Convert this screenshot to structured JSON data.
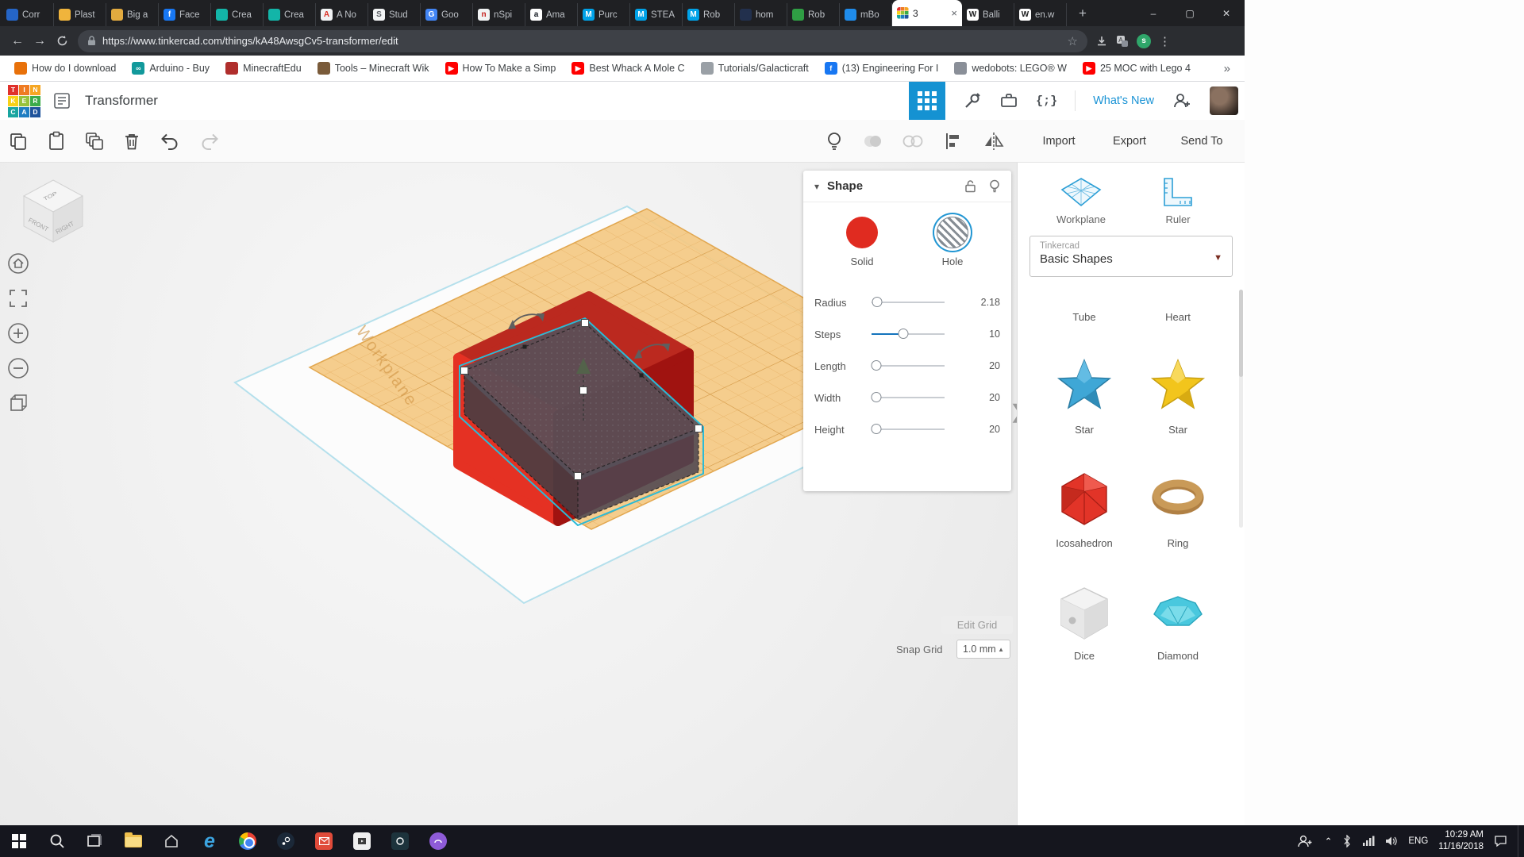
{
  "icons": {
    "back": "←",
    "forward": "→",
    "overflow": "»",
    "menu": "⋮",
    "star": "☆",
    "plus_tab": "+",
    "caret_down": "▾",
    "caret_up": "▲",
    "drop_caret": "▼",
    "collapse_chevron": "❯",
    "tab_close": "×",
    "code_braces": "{;}",
    "window_min": "–",
    "window_max": "▢",
    "window_close": "✕"
  },
  "browser": {
    "tabs": [
      {
        "label": "Corr",
        "fav": "#2565c7",
        "glyph": "",
        "glyph_color": "#ffffff"
      },
      {
        "label": "Plast",
        "fav": "#f0b43c",
        "glyph": "",
        "glyph_color": "#ffffff"
      },
      {
        "label": "Big a",
        "fav": "#e2aa3f",
        "glyph": "",
        "glyph_color": "#ffffff"
      },
      {
        "label": "Face",
        "fav": "#1877f2",
        "glyph": "f",
        "glyph_color": "#ffffff"
      },
      {
        "label": "Crea",
        "fav": "#13b5a8",
        "glyph": "",
        "glyph_color": "#ffffff"
      },
      {
        "label": "Crea",
        "fav": "#13b5a8",
        "glyph": "",
        "glyph_color": "#ffffff"
      },
      {
        "label": "A No",
        "fav": "#f1f3f4",
        "glyph": "A",
        "glyph_color": "#d93025"
      },
      {
        "label": "Stud",
        "fav": "#f1f3f4",
        "glyph": "S",
        "glyph_color": "#5f6368"
      },
      {
        "label": "Goo",
        "fav": "#4285f4",
        "glyph": "G",
        "glyph_color": "#ffffff"
      },
      {
        "label": "nSpi",
        "fav": "#f1f3f4",
        "glyph": "n",
        "glyph_color": "#c5221f"
      },
      {
        "label": "Ama",
        "fav": "#ffffff",
        "glyph": "a",
        "glyph_color": "#131921"
      },
      {
        "label": "Purc",
        "fav": "#00a2e8",
        "glyph": "M",
        "glyph_color": "#ffffff"
      },
      {
        "label": "STEA",
        "fav": "#00a2e8",
        "glyph": "M",
        "glyph_color": "#ffffff"
      },
      {
        "label": "Rob",
        "fav": "#00a2e8",
        "glyph": "M",
        "glyph_color": "#ffffff"
      },
      {
        "label": "hom",
        "fav": "#22304d",
        "glyph": "",
        "glyph_color": "#ffffff"
      },
      {
        "label": "Rob",
        "fav": "#2f9e44",
        "glyph": "",
        "glyph_color": "#ffffff"
      },
      {
        "label": "mBo",
        "fav": "#1f8ceb",
        "glyph": "",
        "glyph_color": "#ffffff"
      },
      {
        "label": "3",
        "active": true
      },
      {
        "label": "Balli",
        "fav": "#ffffff",
        "glyph": "W",
        "glyph_color": "#202122"
      },
      {
        "label": "en.w",
        "fav": "#ffffff",
        "glyph": "W",
        "glyph_color": "#202122"
      }
    ],
    "url": "https://www.tinkercad.com/things/kA48AwsgCv5-transformer/edit",
    "bookmarks": [
      {
        "label": "How do I download",
        "color": "#e8710a",
        "glyph": ""
      },
      {
        "label": "Arduino - Buy",
        "color": "#12999b",
        "glyph": "∞"
      },
      {
        "label": "MinecraftEdu",
        "color": "#b02e2c",
        "glyph": ""
      },
      {
        "label": "Tools – Minecraft Wik",
        "color": "#7a5b3a",
        "glyph": ""
      },
      {
        "label": "How To Make a Simp",
        "color": "#ff0000",
        "glyph": "▶"
      },
      {
        "label": "Best Whack A Mole C",
        "color": "#ff0000",
        "glyph": "▶"
      },
      {
        "label": "Tutorials/Galacticraft",
        "color": "#9aa0a6",
        "glyph": ""
      },
      {
        "label": "(13) Engineering For I",
        "color": "#1877f2",
        "glyph": "f"
      },
      {
        "label": "wedobots: LEGO® W",
        "color": "#8a8f98",
        "glyph": ""
      },
      {
        "label": "25 MOC with Lego 4",
        "color": "#ff0000",
        "glyph": "▶"
      }
    ]
  },
  "tinkercad": {
    "logo_letters": [
      "T",
      "I",
      "N",
      "K",
      "E",
      "R",
      "C",
      "A",
      "D"
    ],
    "logo_colors": [
      "#e0312c",
      "#ef7b22",
      "#f5a623",
      "#f7d117",
      "#97c23c",
      "#3bab49",
      "#19a5a0",
      "#1f7ec2",
      "#20549c"
    ],
    "title": "Transformer",
    "whats_new": "What's New",
    "toolbar": {
      "import": "Import",
      "export": "Export",
      "send_to": "Send To"
    },
    "viewcube": {
      "top": "TOP",
      "front": "FRONT",
      "right": "RIGHT"
    },
    "workplane_watermark": "Workplane",
    "shape_panel": {
      "title": "Shape",
      "solid_label": "Solid",
      "hole_label": "Hole",
      "sliders": [
        {
          "label": "Radius",
          "value": "2.18",
          "pos": 8,
          "fill": 0
        },
        {
          "label": "Steps",
          "value": "10",
          "pos": 44,
          "fill": 44
        },
        {
          "label": "Length",
          "value": "20",
          "pos": 6,
          "fill": 0
        },
        {
          "label": "Width",
          "value": "20",
          "pos": 6,
          "fill": 0
        },
        {
          "label": "Height",
          "value": "20",
          "pos": 6,
          "fill": 0
        }
      ]
    },
    "sidebar": {
      "workplane_label": "Workplane",
      "ruler_label": "Ruler",
      "dropdown_category": "Tinkercad",
      "dropdown_value": "Basic Shapes",
      "shapes": [
        {
          "label": "Tube"
        },
        {
          "label": "Heart"
        },
        {
          "label": "Star"
        },
        {
          "label": "Star"
        },
        {
          "label": "Icosahedron"
        },
        {
          "label": "Ring"
        },
        {
          "label": "Dice"
        },
        {
          "label": "Diamond"
        }
      ]
    },
    "grid_controls": {
      "edit_grid": "Edit Grid",
      "snap_grid": "Snap Grid",
      "snap_value": "1.0 mm"
    }
  },
  "taskbar": {
    "lang": "ENG",
    "time": "10:29 AM",
    "date": "11/16/2018"
  }
}
